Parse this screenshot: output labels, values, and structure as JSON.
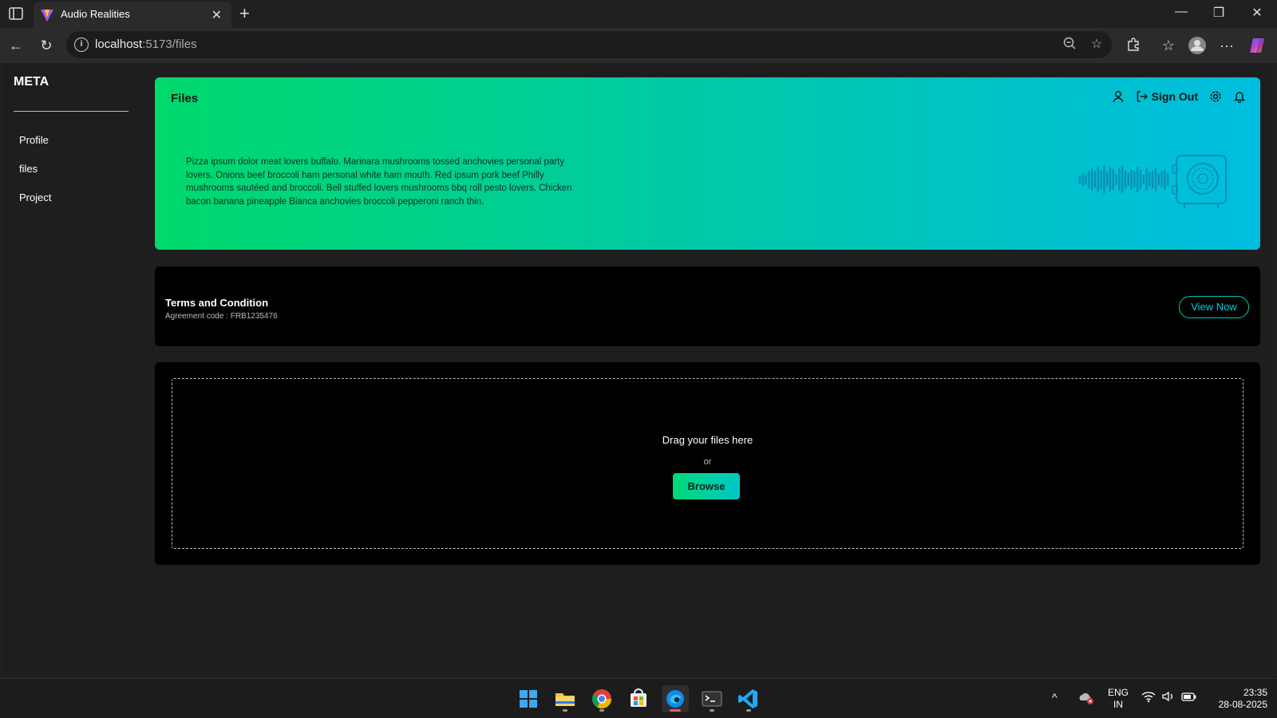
{
  "browser": {
    "tab_title": "Audio Realities",
    "url_host": "localhost",
    "url_path": ":5173/files",
    "icons": [
      "sidebar-toggle-icon",
      "close-icon",
      "plus-icon",
      "back-icon",
      "reload-icon",
      "info-icon",
      "zoom-out-icon",
      "star-icon",
      "extensions-icon",
      "favorites-icon",
      "profile-icon",
      "more-icon",
      "copilot-icon"
    ]
  },
  "app": {
    "brand": "META",
    "nav": [
      {
        "label": "Profile"
      },
      {
        "label": "files"
      },
      {
        "label": "Project"
      }
    ],
    "hero": {
      "title": "Files",
      "description": "Pizza ipsum dolor meat lovers buffalo. Marinara mushrooms tossed anchovies personal party lovers. Onions beef broccoli ham personal white ham mouth. Red ipsum pork beef Philly mushrooms sautéed and broccoli. Bell stuffed lovers mushrooms bbq roll pesto lovers. Chicken bacon banana pineapple Bianca anchovies broccoli pepperoni ranch thin.",
      "sign_out_label": "Sign Out",
      "gradient_start": "#00d96b",
      "gradient_end": "#00bde0"
    },
    "terms": {
      "title": "Terms and Condition",
      "agreement_code": "Agreement code : FRB1235476",
      "view_label": "View Now"
    },
    "upload": {
      "drag_text": "Drag your files here",
      "or_text": "or",
      "browse_label": "Browse"
    }
  },
  "taskbar": {
    "apps": [
      "windows-start-icon",
      "file-explorer-icon",
      "chrome-icon",
      "store-icon",
      "edge-icon",
      "terminal-icon",
      "vscode-icon"
    ],
    "language": "ENG",
    "region": "IN",
    "time": "23:35",
    "date": "28-08-2025"
  }
}
